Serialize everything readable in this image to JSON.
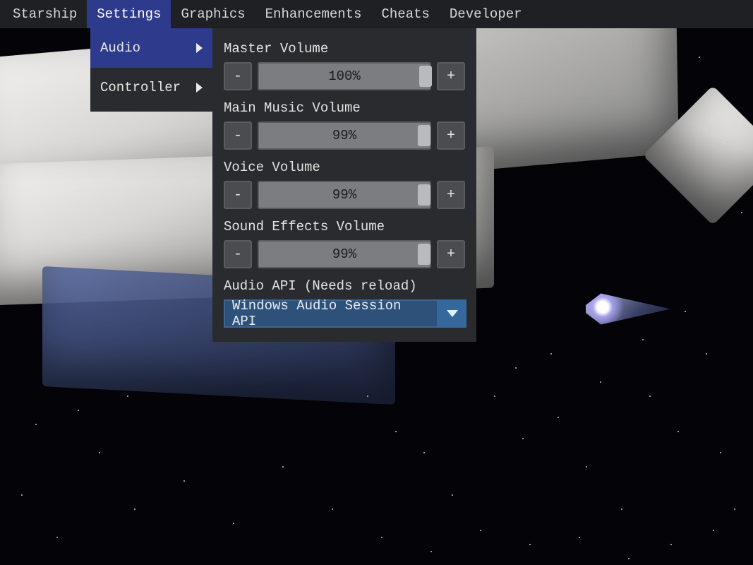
{
  "menubar": {
    "items": [
      "Starship",
      "Settings",
      "Graphics",
      "Enhancements",
      "Cheats",
      "Developer"
    ],
    "active_index": 1
  },
  "submenu": {
    "items": [
      {
        "label": "Audio",
        "has_children": true,
        "selected": true
      },
      {
        "label": "Controller",
        "has_children": true,
        "selected": false
      }
    ]
  },
  "panel": {
    "settings": [
      {
        "label": "Master Volume",
        "value": 100,
        "display": "100%"
      },
      {
        "label": "Main Music Volume",
        "value": 99,
        "display": "99%"
      },
      {
        "label": "Voice Volume",
        "value": 99,
        "display": "99%"
      },
      {
        "label": "Sound Effects Volume",
        "value": 99,
        "display": "99%"
      }
    ],
    "audio_api": {
      "label": "Audio API (Needs reload)",
      "selected": "Windows Audio Session API"
    },
    "buttons": {
      "minus": "-",
      "plus": "+"
    }
  }
}
